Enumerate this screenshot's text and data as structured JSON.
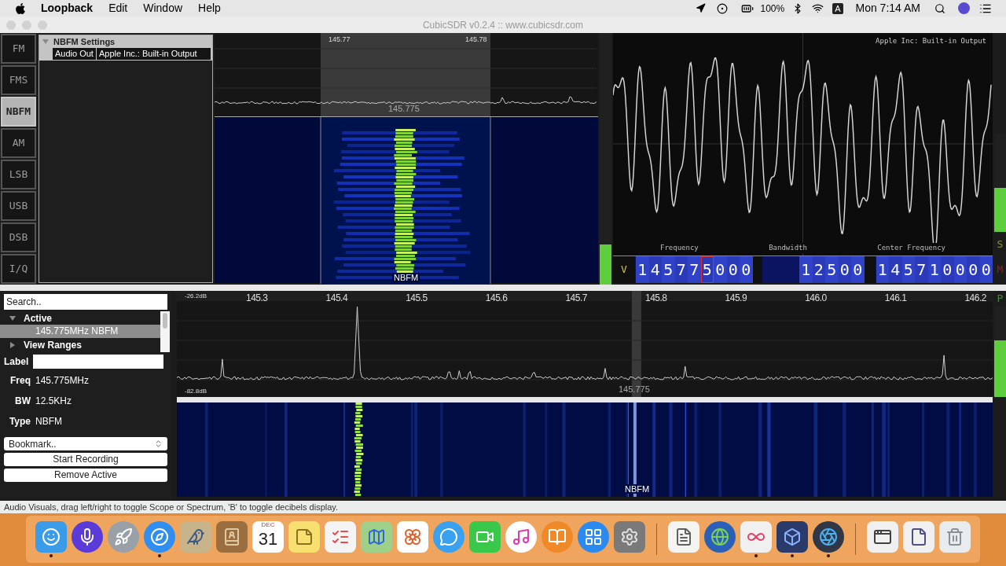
{
  "menu_bar": {
    "app": "Loopback",
    "items": [
      "Edit",
      "Window",
      "Help"
    ],
    "battery": "100%",
    "input_source": "A",
    "clock": "Mon 7:14 AM"
  },
  "window": {
    "title": "CubicSDR v0.2.4 :: www.cubicsdr.com"
  },
  "modes": [
    {
      "label": "FM",
      "selected": false
    },
    {
      "label": "FMS",
      "selected": false
    },
    {
      "label": "NBFM",
      "selected": true
    },
    {
      "label": "AM",
      "selected": false
    },
    {
      "label": "LSB",
      "selected": false
    },
    {
      "label": "USB",
      "selected": false
    },
    {
      "label": "DSB",
      "selected": false
    },
    {
      "label": "I/Q",
      "selected": false
    }
  ],
  "settings": {
    "title": "NBFM Settings",
    "expanded": true,
    "audio_out_label": "Audio Out",
    "audio_out_value": "Apple Inc.: Built-in Output"
  },
  "zoom_spectrum": {
    "ticks": [
      "145.77",
      "145.78"
    ],
    "center_label": "145.775",
    "marker_label": "NBFM"
  },
  "audio_meter": {
    "level": 0.16
  },
  "scope": {
    "device": "Apple Inc: Built-in Output",
    "field_labels": [
      "Frequency",
      "Bandwidth",
      "Center Frequency"
    ]
  },
  "tuner": {
    "mode_label": "V",
    "groups": [
      {
        "digits": [
          {
            "d": "1",
            "selected": false
          },
          {
            "d": "4",
            "selected": false
          },
          {
            "d": "5",
            "selected": false
          },
          {
            "d": "7",
            "selected": false
          },
          {
            "d": "7",
            "selected": false
          },
          {
            "d": "5",
            "selected": true
          },
          {
            "d": "0",
            "selected": false
          },
          {
            "d": "0",
            "selected": false
          },
          {
            "d": "0",
            "selected": false
          }
        ]
      },
      {
        "digits": [
          {
            "d": "1",
            "selected": false
          },
          {
            "d": "2",
            "selected": false
          },
          {
            "d": "5",
            "selected": false
          },
          {
            "d": "0",
            "selected": false
          },
          {
            "d": "0",
            "selected": false
          }
        ]
      },
      {
        "digits": [
          {
            "d": "1",
            "selected": false
          },
          {
            "d": "4",
            "selected": false
          },
          {
            "d": "5",
            "selected": false
          },
          {
            "d": "7",
            "selected": false
          },
          {
            "d": "1",
            "selected": false
          },
          {
            "d": "0",
            "selected": false
          },
          {
            "d": "0",
            "selected": false
          },
          {
            "d": "0",
            "selected": false
          },
          {
            "d": "0",
            "selected": false
          }
        ]
      }
    ]
  },
  "side_labels": [
    {
      "label": "S",
      "color": "#8c8c3c"
    },
    {
      "label": "M",
      "color": "#8c2222"
    }
  ],
  "gain_meter": {
    "level": 0.45
  },
  "bookmarks": {
    "search_placeholder": "Search..",
    "groups": [
      {
        "label": "Active",
        "expanded": true,
        "children": [
          {
            "label": "145.775MHz NBFM",
            "selected": true
          }
        ]
      },
      {
        "label": "View Ranges",
        "expanded": false
      }
    ]
  },
  "details": {
    "label_field": "Label",
    "rows": [
      {
        "name": "Freq",
        "value": "145.775MHz"
      },
      {
        "name": "BW",
        "value": "12.5KHz"
      },
      {
        "name": "Type",
        "value": "NBFM"
      }
    ],
    "bookmark_select": "Bookmark..",
    "buttons": [
      "Start Recording",
      "Remove Active"
    ]
  },
  "main_spectrum": {
    "db_top": "-26.2dB",
    "db_bottom": "-82.8dB",
    "ticks": [
      "145.3",
      "145.4",
      "145.5",
      "145.6",
      "145.7",
      "145.8",
      "145.9",
      "146.0",
      "146.1",
      "146.2"
    ],
    "center_label": "145.775",
    "side_label": {
      "label": "P",
      "color": "#3c8c3c"
    }
  },
  "peak_meter": {
    "level": 0.63
  },
  "waterfall": {
    "marker_label": "NBFM"
  },
  "status_bar": "Audio Visuals, drag left/right to toggle Scope or Spectrum, 'B' to toggle decibels display.",
  "dock": [
    {
      "kind": "finder",
      "running": true
    },
    {
      "kind": "siri",
      "running": false
    },
    {
      "kind": "launchpad",
      "running": false
    },
    {
      "kind": "safari",
      "running": true
    },
    {
      "kind": "mail",
      "running": false
    },
    {
      "kind": "contacts",
      "running": false
    },
    {
      "kind": "calendar",
      "running": false,
      "month": "DEC",
      "day": "31"
    },
    {
      "kind": "notes",
      "running": false
    },
    {
      "kind": "reminders",
      "running": false
    },
    {
      "kind": "maps",
      "running": false
    },
    {
      "kind": "photos",
      "running": false
    },
    {
      "kind": "messages",
      "running": false
    },
    {
      "kind": "facetime",
      "running": false
    },
    {
      "kind": "music",
      "running": false
    },
    {
      "kind": "books",
      "running": false
    },
    {
      "kind": "appstore",
      "running": false
    },
    {
      "kind": "settings",
      "running": false
    },
    {
      "kind": "separator"
    },
    {
      "kind": "textedit",
      "running": false
    },
    {
      "kind": "globe",
      "running": false
    },
    {
      "kind": "rings",
      "running": true
    },
    {
      "kind": "cube",
      "running": true
    },
    {
      "kind": "quicktime",
      "running": true
    },
    {
      "kind": "separator"
    },
    {
      "kind": "window",
      "running": false
    },
    {
      "kind": "document",
      "running": false
    },
    {
      "kind": "trash",
      "running": false
    }
  ]
}
